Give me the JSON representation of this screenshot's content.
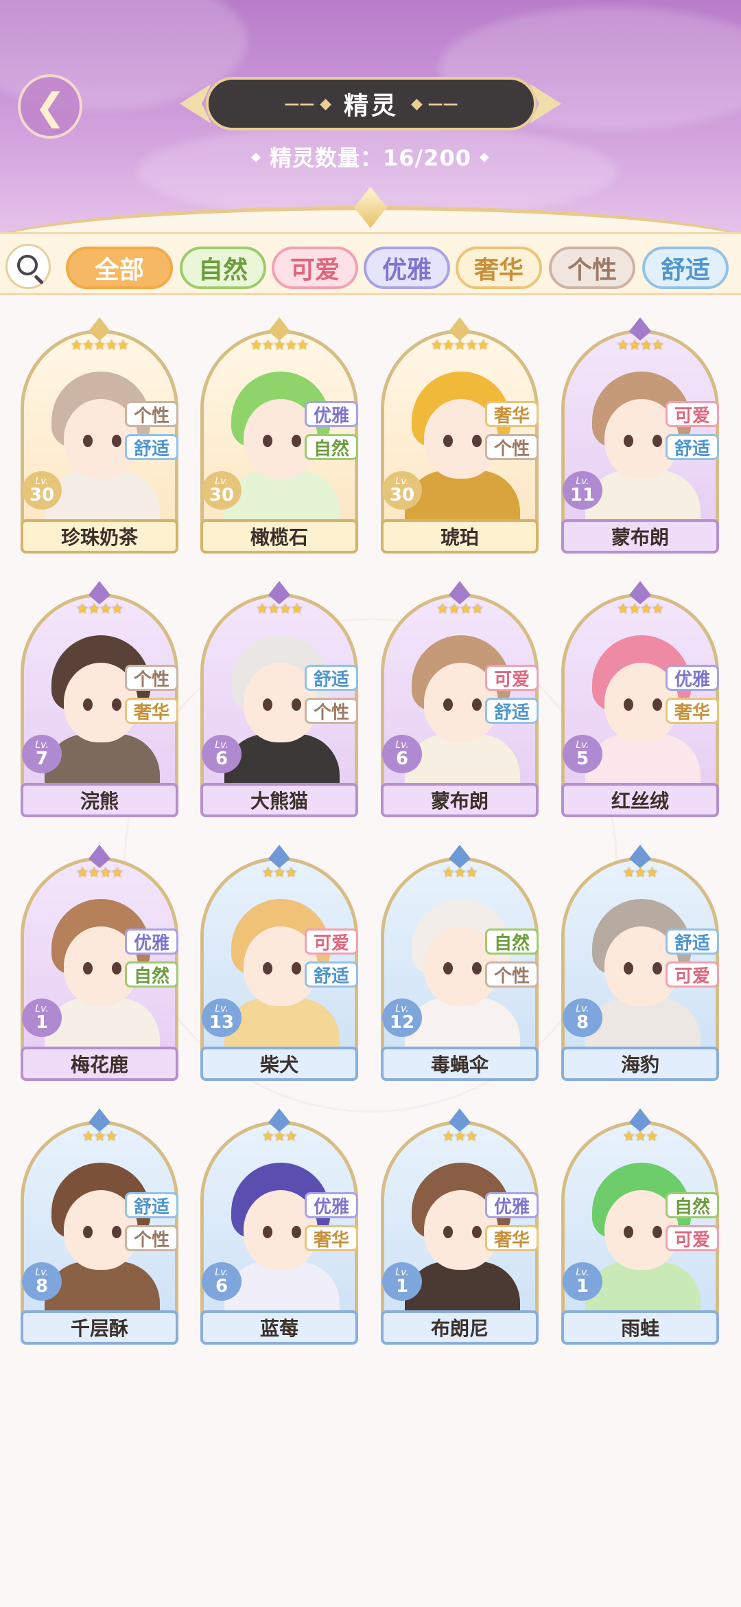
{
  "header": {
    "back_icon": "back-arrow-icon",
    "title": "精灵",
    "count_text": "精灵数量：16/200"
  },
  "filters": [
    {
      "label": "全部",
      "bg": "#f6b863",
      "border": "#f3a949",
      "color": "#ffffff"
    },
    {
      "label": "自然",
      "bg": "#e9f6d8",
      "border": "#9fcb6e",
      "color": "#6c9c3c"
    },
    {
      "label": "可爱",
      "bg": "#fde1e6",
      "border": "#f2a1b2",
      "color": "#e0667e"
    },
    {
      "label": "优雅",
      "bg": "#e6e4fb",
      "border": "#a8a2e6",
      "color": "#7d75cf"
    },
    {
      "label": "奢华",
      "bg": "#fdf1d6",
      "border": "#e9c57a",
      "color": "#c6913a"
    },
    {
      "label": "个性",
      "bg": "#f1e6df",
      "border": "#cdb3a3",
      "color": "#9b7a66"
    },
    {
      "label": "舒适",
      "bg": "#e2f0fb",
      "border": "#93c2e6",
      "color": "#4f95cd"
    }
  ],
  "tag_styles": {
    "自然": {
      "color": "#6c9c3c",
      "border": "#9fcb6e"
    },
    "可爱": {
      "color": "#e0667e",
      "border": "#f2a1b2"
    },
    "优雅": {
      "color": "#7d75cf",
      "border": "#a8a2e6"
    },
    "奢华": {
      "color": "#c6913a",
      "border": "#e9c57a"
    },
    "个性": {
      "color": "#9b7a66",
      "border": "#cdb3a3"
    },
    "舒适": {
      "color": "#4f95cd",
      "border": "#93c2e6"
    }
  },
  "spirits": [
    {
      "name": "珍珠奶茶",
      "level": "30",
      "stars": "★★★★★",
      "rarity": 5,
      "tags": [
        "个性",
        "舒适"
      ],
      "hair": "#cdb5a6",
      "outfit": "#f3ede6"
    },
    {
      "name": "橄榄石",
      "level": "30",
      "stars": "★★★★★",
      "rarity": 5,
      "tags": [
        "优雅",
        "自然"
      ],
      "hair": "#8ed46a",
      "outfit": "#e6f4d6"
    },
    {
      "name": "琥珀",
      "level": "30",
      "stars": "★★★★★",
      "rarity": 5,
      "tags": [
        "奢华",
        "个性"
      ],
      "hair": "#f0b93a",
      "outfit": "#d9a43d"
    },
    {
      "name": "蒙布朗",
      "level": "11",
      "stars": "★★★★",
      "rarity": 4,
      "tags": [
        "可爱",
        "舒适"
      ],
      "hair": "#c59a78",
      "outfit": "#f7efe1"
    },
    {
      "name": "浣熊",
      "level": "7",
      "stars": "★★★★",
      "rarity": 4,
      "tags": [
        "个性",
        "奢华"
      ],
      "hair": "#5a4238",
      "outfit": "#7d6a5c"
    },
    {
      "name": "大熊猫",
      "level": "6",
      "stars": "★★★★",
      "rarity": 4,
      "tags": [
        "舒适",
        "个性"
      ],
      "hair": "#e9e6e3",
      "outfit": "#3c3838"
    },
    {
      "name": "蒙布朗",
      "level": "6",
      "stars": "★★★★",
      "rarity": 4,
      "tags": [
        "可爱",
        "舒适"
      ],
      "hair": "#c59a78",
      "outfit": "#f7efe1"
    },
    {
      "name": "红丝绒",
      "level": "5",
      "stars": "★★★★",
      "rarity": 4,
      "tags": [
        "优雅",
        "奢华"
      ],
      "hair": "#ee8aa4",
      "outfit": "#fbe6ec"
    },
    {
      "name": "梅花鹿",
      "level": "1",
      "stars": "★★★★",
      "rarity": 4,
      "tags": [
        "优雅",
        "自然"
      ],
      "hair": "#b5805a",
      "outfit": "#f5efe8"
    },
    {
      "name": "柴犬",
      "level": "13",
      "stars": "★★★",
      "rarity": 3,
      "tags": [
        "可爱",
        "舒适"
      ],
      "hair": "#efc277",
      "outfit": "#f4d697"
    },
    {
      "name": "毒蝇伞",
      "level": "12",
      "stars": "★★★",
      "rarity": 3,
      "tags": [
        "自然",
        "个性"
      ],
      "hair": "#f3ede9",
      "outfit": "#f7f2ef"
    },
    {
      "name": "海豹",
      "level": "8",
      "stars": "★★★",
      "rarity": 3,
      "tags": [
        "舒适",
        "可爱"
      ],
      "hair": "#b7aaa0",
      "outfit": "#ece7e3"
    },
    {
      "name": "千层酥",
      "level": "8",
      "stars": "★★★",
      "rarity": 3,
      "tags": [
        "舒适",
        "个性"
      ],
      "hair": "#7b5239",
      "outfit": "#8b6146"
    },
    {
      "name": "蓝莓",
      "level": "6",
      "stars": "★★★",
      "rarity": 3,
      "tags": [
        "优雅",
        "奢华"
      ],
      "hair": "#5b4eb1",
      "outfit": "#f0eef8"
    },
    {
      "name": "布朗尼",
      "level": "1",
      "stars": "★★★",
      "rarity": 3,
      "tags": [
        "优雅",
        "奢华"
      ],
      "hair": "#8a5e44",
      "outfit": "#4b3a33"
    },
    {
      "name": "雨蛙",
      "level": "1",
      "stars": "★★★",
      "rarity": 3,
      "tags": [
        "自然",
        "可爱"
      ],
      "hair": "#6ccd6a",
      "outfit": "#c9eab7"
    }
  ],
  "lv_label": "Lv."
}
